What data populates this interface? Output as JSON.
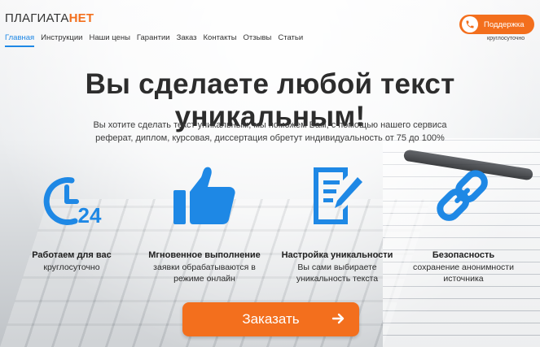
{
  "logo": {
    "main": "ПЛАГИАТА",
    "accent": "НЕТ"
  },
  "nav": [
    {
      "label": "Главная",
      "active": true
    },
    {
      "label": "Инструкции"
    },
    {
      "label": "Наши цены"
    },
    {
      "label": "Гарантии"
    },
    {
      "label": "Заказ"
    },
    {
      "label": "Контакты"
    },
    {
      "label": "Отзывы"
    },
    {
      "label": "Статьи"
    }
  ],
  "support": {
    "label": "Поддержка",
    "subtitle": "круглосуточно",
    "icon": "phone-icon"
  },
  "hero": {
    "title": "Вы сделаете любой текст уникальным!",
    "subtitle_line1": "Вы хотите сделать текст уникальным, мы поможем Вам, с помощью нашего сервиса",
    "subtitle_line2": "реферат, диплом, курсовая, диссертация обретут индивидуальность от 75 до 100%"
  },
  "features": [
    {
      "icon": "clock-24-icon",
      "title": "Работаем для вас",
      "desc_line1": "круглосуточно",
      "desc_line2": ""
    },
    {
      "icon": "thumbs-up-icon",
      "title": "Мгновенное выполнение",
      "desc_line1": "заявки обрабатываются в",
      "desc_line2": "режиме онлайн"
    },
    {
      "icon": "document-edit-icon",
      "title": "Настройка уникальности",
      "desc_line1": "Вы сами выбираете",
      "desc_line2": "уникальность текста"
    },
    {
      "icon": "chain-link-icon",
      "title": "Безопасность",
      "desc_line1": "сохранение анонимности",
      "desc_line2": "источника"
    }
  ],
  "cta": {
    "label": "Заказать",
    "icon": "arrow-right-icon"
  },
  "colors": {
    "accent": "#f36f1d",
    "blue": "#1e88e5",
    "text": "#2d2d2d"
  }
}
